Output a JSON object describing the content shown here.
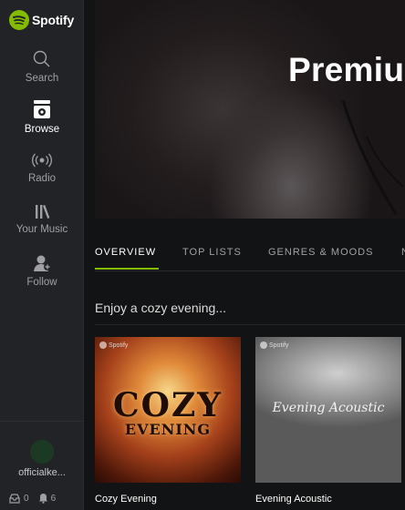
{
  "app": {
    "name": "Spotify",
    "accent": "#84bd00"
  },
  "sidebar": {
    "items": [
      {
        "label": "Search",
        "icon": "search-icon"
      },
      {
        "label": "Browse",
        "icon": "browse-icon",
        "active": true
      },
      {
        "label": "Radio",
        "icon": "radio-icon"
      },
      {
        "label": "Your Music",
        "icon": "your-music-icon"
      },
      {
        "label": "Follow",
        "icon": "follow-icon"
      }
    ],
    "user": {
      "name": "officialke...",
      "notifications": "0",
      "followers": "6"
    }
  },
  "hero": {
    "title": "Premiu"
  },
  "tabs": [
    {
      "label": "OVERVIEW",
      "active": true
    },
    {
      "label": "TOP LISTS"
    },
    {
      "label": "GENRES & MOODS"
    },
    {
      "label": "N"
    }
  ],
  "section": {
    "title": "Enjoy a cozy evening...",
    "playlists": [
      {
        "title": "Cozy Evening",
        "art_text_1": "COZY",
        "art_text_2": "EVENING",
        "badge": "Spotify"
      },
      {
        "title": "Evening Acoustic",
        "art_text": "Evening Acoustic",
        "badge": "Spotify"
      }
    ]
  }
}
